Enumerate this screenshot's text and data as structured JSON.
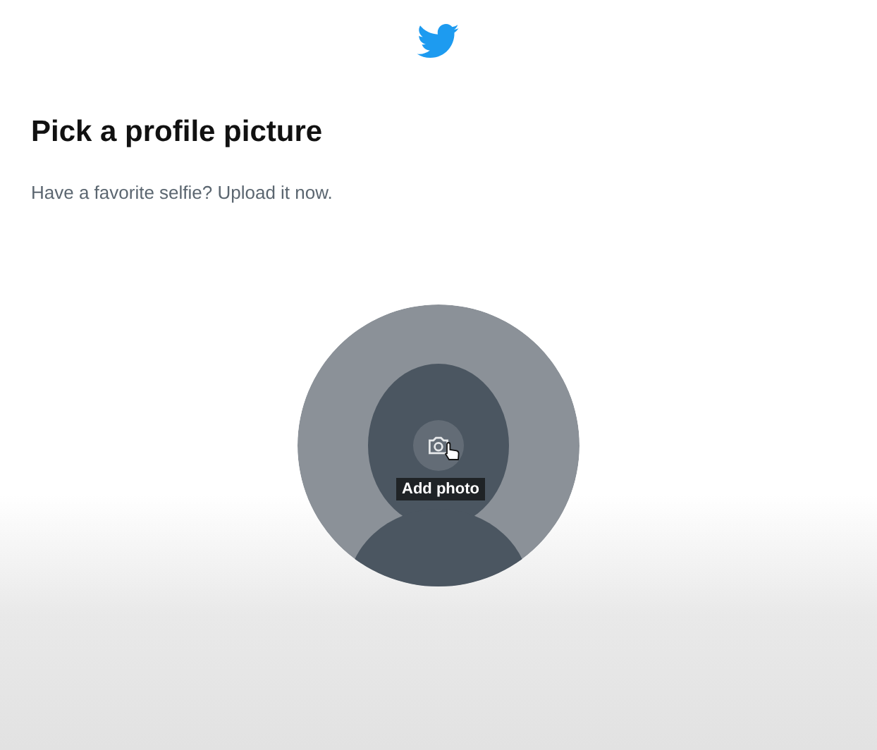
{
  "title": "Pick a profile picture",
  "subtitle": "Have a favorite selfie? Upload it now.",
  "avatar": {
    "tooltip": "Add photo"
  }
}
